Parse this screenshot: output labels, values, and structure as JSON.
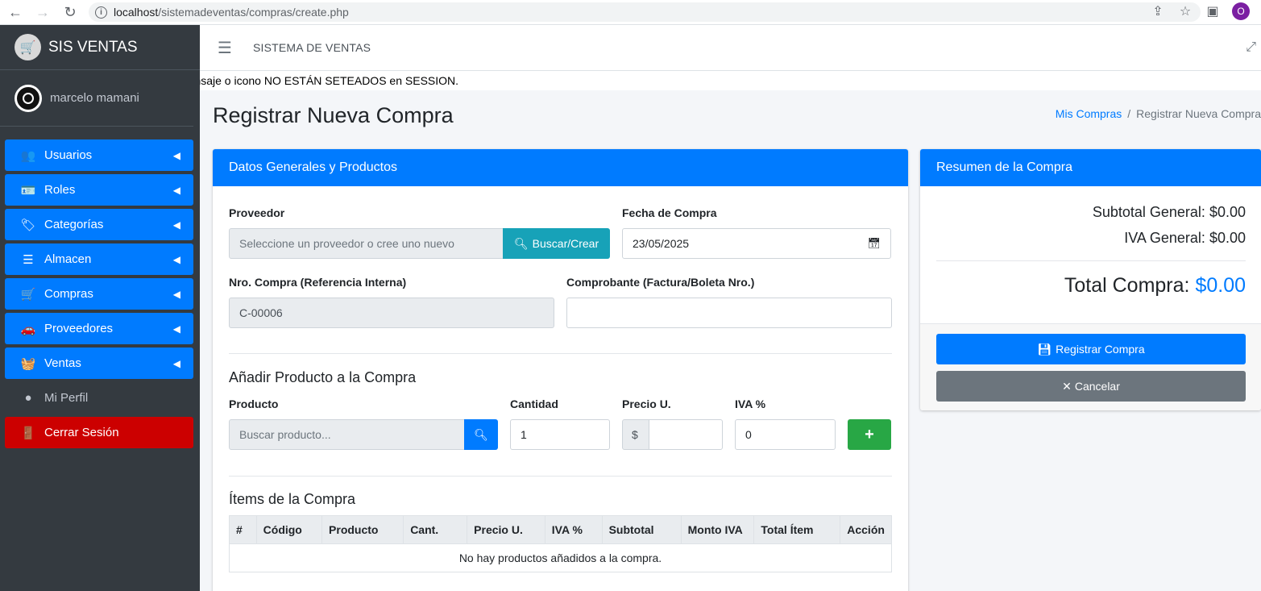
{
  "browser": {
    "url_host": "localhost",
    "url_path": "/sistemadeventas/compras/create.php",
    "profile_initial": "O"
  },
  "sidebar": {
    "brand": "SIS VENTAS",
    "user": "marcelo mamani",
    "items": [
      {
        "label": "Usuarios",
        "icon": "users-icon",
        "glyph": "👥",
        "color": "blue",
        "expandable": true
      },
      {
        "label": "Roles",
        "icon": "id-card-icon",
        "glyph": "🪪",
        "color": "blue",
        "expandable": true
      },
      {
        "label": "Categorías",
        "icon": "tags-icon",
        "glyph": "🏷",
        "color": "blue",
        "expandable": true
      },
      {
        "label": "Almacen",
        "icon": "list-icon",
        "glyph": "☰",
        "color": "blue",
        "expandable": true
      },
      {
        "label": "Compras",
        "icon": "cart-icon",
        "glyph": "🛒",
        "color": "blue",
        "expandable": true
      },
      {
        "label": "Proveedores",
        "icon": "car-icon",
        "glyph": "🚗",
        "color": "blue",
        "expandable": true
      },
      {
        "label": "Ventas",
        "icon": "basket-icon",
        "glyph": "🧺",
        "color": "blue",
        "expandable": true
      },
      {
        "label": "Mi Perfil",
        "icon": "user-circle-icon",
        "glyph": "●",
        "color": "plain",
        "expandable": false
      },
      {
        "label": "Cerrar Sesión",
        "icon": "door-icon",
        "glyph": "🚪",
        "color": "red",
        "expandable": false
      }
    ]
  },
  "topbar": {
    "title": "SISTEMA DE VENTAS"
  },
  "session_message": "Mensaje o icono NO ESTÁN SETEADOS en SESSION.",
  "page": {
    "title": "Registrar Nueva Compra",
    "breadcrumb_link": "Mis Compras",
    "breadcrumb_current": "Registrar Nueva Compra"
  },
  "main_card": {
    "header": "Datos Generales y Productos",
    "proveedor_label": "Proveedor",
    "proveedor_placeholder": "Seleccione un proveedor o cree uno nuevo",
    "buscar_crear": "Buscar/Crear",
    "fecha_label": "Fecha de Compra",
    "fecha_value": "23/05/2025",
    "nro_label": "Nro. Compra (Referencia Interna)",
    "nro_value": "C-00006",
    "comprobante_label": "Comprobante (Factura/Boleta Nro.)",
    "comprobante_value": "",
    "add_title": "Añadir Producto a la Compra",
    "producto_label": "Producto",
    "producto_placeholder": "Buscar producto...",
    "cantidad_label": "Cantidad",
    "cantidad_value": "1",
    "precio_label": "Precio U.",
    "precio_prefix": "$",
    "precio_value": "",
    "iva_label": "IVA %",
    "iva_value": "0",
    "items_title": "Ítems de la Compra",
    "table_headers": [
      "#",
      "Código",
      "Producto",
      "Cant.",
      "Precio U.",
      "IVA %",
      "Subtotal",
      "Monto IVA",
      "Total Ítem",
      "Acción"
    ],
    "empty_message": "No hay productos añadidos a la compra."
  },
  "summary": {
    "header": "Resumen de la Compra",
    "subtotal_label": "Subtotal General:",
    "subtotal_value": "$0.00",
    "iva_label": "IVA General:",
    "iva_value": "$0.00",
    "total_label": "Total Compra:",
    "total_value": "$0.00",
    "register_button": "Registrar Compra",
    "cancel_button": "Cancelar"
  }
}
